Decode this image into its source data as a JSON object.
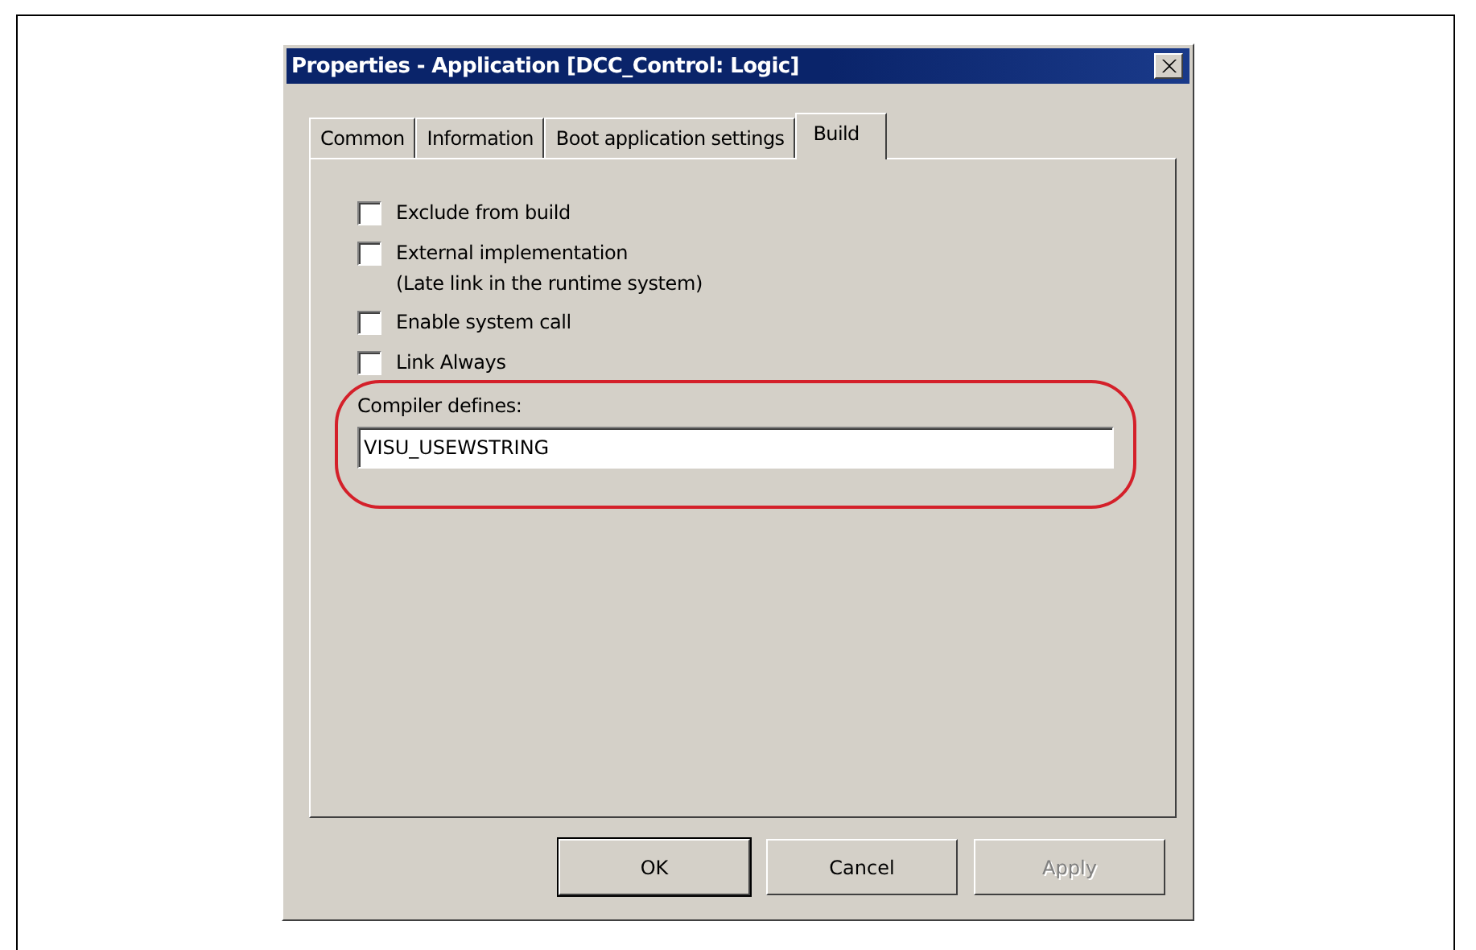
{
  "window": {
    "title": "Properties - Application [DCC_Control: Logic]"
  },
  "tabs": [
    {
      "label": "Common",
      "selected": false
    },
    {
      "label": "Information",
      "selected": false
    },
    {
      "label": "Boot application settings",
      "selected": false
    },
    {
      "label": "Build",
      "selected": true
    }
  ],
  "options": [
    {
      "label": "Exclude from build",
      "checked": false
    },
    {
      "label": "External implementation",
      "note": "(Late link in the runtime system)",
      "checked": false
    },
    {
      "label": "Enable system call",
      "checked": false
    },
    {
      "label": "Link Always",
      "checked": false
    }
  ],
  "compiler_defines": {
    "label": "Compiler defines:",
    "value": "VISU_USEWSTRING",
    "highlighted": true
  },
  "buttons": [
    {
      "label": "OK",
      "default": true,
      "disabled": false
    },
    {
      "label": "Cancel",
      "default": false,
      "disabled": false
    },
    {
      "label": "Apply",
      "default": false,
      "disabled": true
    }
  ]
}
